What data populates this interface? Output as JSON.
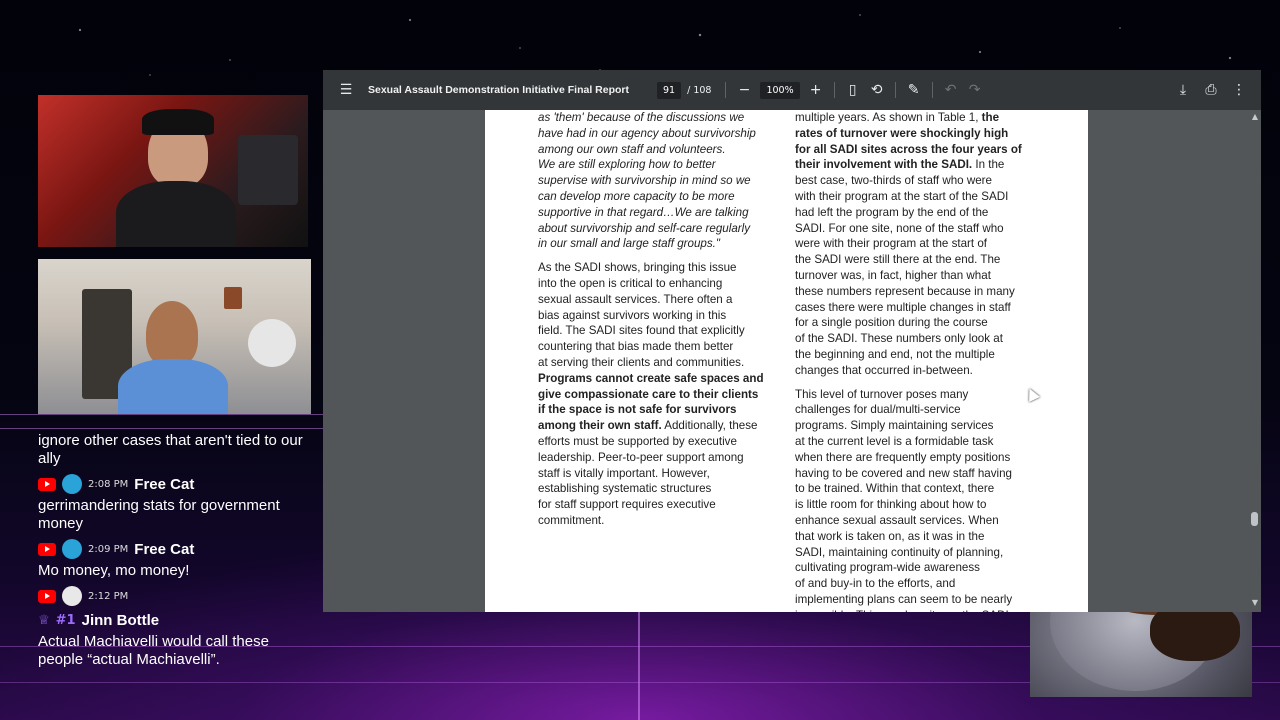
{
  "viewer": {
    "title": "Sexual Assault Demonstration Initiative Final Report",
    "current_page": "91",
    "total_pages": "/ 108",
    "zoom": "100%"
  },
  "document": {
    "left_column": {
      "quote": [
        "as 'them' because of the discussions we",
        "have had in our agency about survivorship",
        "among our own staff and volunteers.",
        "We are still exploring how to better",
        "supervise with survivorship in mind so we",
        "can develop more capacity to be more",
        "supportive in that regard…We are talking",
        "about survivorship and self-care regularly",
        "in our small and large staff groups.\""
      ],
      "para2_intro": [
        "As the SADI shows, bringing this issue",
        "into the open is critical to enhancing",
        "sexual assault services. There often a",
        "bias against survivors working in this",
        "field. The SADI sites found that explicitly",
        "countering that bias made them better",
        "at serving their clients and communities."
      ],
      "para2_bold": [
        "Programs cannot create safe spaces and",
        "give compassionate care to their clients",
        "if the space is not safe for survivors",
        "among their own staff."
      ],
      "para2_rest": [
        " Additionally, these",
        "efforts must be supported by executive",
        "leadership. Peer-to-peer support among",
        "staff is vitally important. However,",
        "establishing systematic structures",
        "for staff support requires executive",
        "commitment."
      ]
    },
    "right_column": {
      "para1_start": "multiple years. As shown in Table 1, ",
      "para1_bold": [
        "the",
        "rates of turnover were shockingly high",
        "for all SADI sites across the four years of",
        "their involvement with the SADI."
      ],
      "para1_rest": [
        " In the",
        "best case, two-thirds of staff who were",
        "with their program at the start of the SADI",
        "had left the program by the end of the",
        "SADI. For one site, none of the staff who",
        "were with their program at the start of",
        "the SADI were still there at the end. The",
        "turnover was, in fact, higher than what",
        "these numbers represent because in many",
        "cases there were multiple changes in staff",
        "for a single position during the course",
        "of the SADI. These numbers only look at",
        "the beginning and end, not the multiple",
        "changes that occurred in-between."
      ],
      "para2": [
        "This level of turnover poses many",
        "challenges for dual/multi-service",
        "programs. Simply maintaining services",
        "at the current level is a formidable task",
        "when there are frequently empty positions",
        "having to be covered and new staff having",
        "to be trained. Within that context, there",
        "is little room for thinking about how to",
        "enhance sexual assault services. When",
        "that work is taken on, as it was in the",
        "SADI, maintaining continuity of planning,",
        "cultivating program-wide awareness",
        "of and buy-in to the efforts, and",
        "implementing plans can seem to be nearly",
        "impossible. This was how it was the SADI"
      ]
    }
  },
  "chat": {
    "messages": [
      {
        "text": "ignore other cases that aren't tied to our ally"
      },
      {
        "platform": "youtube",
        "time": "2:08 PM",
        "user": "Free Cat",
        "text": "gerrimandering stats for government money"
      },
      {
        "platform": "youtube",
        "time": "2:09 PM",
        "user": "Free Cat",
        "text": "Mo money, mo money!"
      },
      {
        "platform": "youtube",
        "time": "2:12 PM",
        "badge": "#1",
        "user": "Jinn Bottle",
        "text": "Actual Machiavelli would call these people “actual Machiavelli”."
      }
    ]
  },
  "colors": {
    "toolbar_bg": "#323639",
    "viewer_bg": "#525659",
    "youtube_red": "#ff0000",
    "badge_purple": "#9b6bff"
  },
  "icons": {
    "menu": "hamburger-menu-icon",
    "zoom_out": "minus-icon",
    "zoom_in": "plus-icon",
    "fit": "fit-page-icon",
    "rotate": "rotate-icon",
    "annotate": "pen-icon",
    "undo": "undo-icon",
    "redo": "redo-icon",
    "download": "download-icon",
    "print": "print-icon",
    "more": "more-vert-icon"
  }
}
